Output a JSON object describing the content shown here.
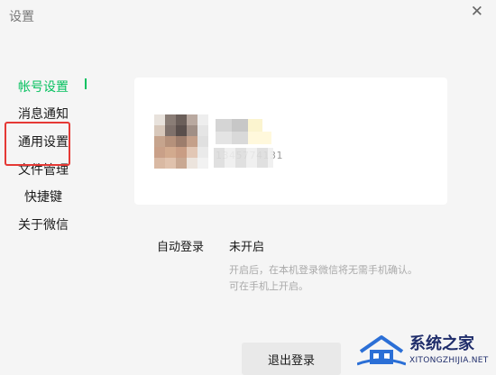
{
  "window": {
    "title": "设置"
  },
  "sidebar": {
    "items": [
      {
        "label": "帐号设置",
        "active": true
      },
      {
        "label": "消息通知"
      },
      {
        "label": "通用设置"
      },
      {
        "label": "文件管理"
      },
      {
        "label": "快捷键"
      },
      {
        "label": "关于微信"
      }
    ]
  },
  "account": {
    "wechat_id": "1345774131"
  },
  "auto_login": {
    "label": "自动登录",
    "value": "未开启",
    "desc_line1": "开启后，在本机登录微信将无需手机确认。",
    "desc_line2": "可在手机上开启。"
  },
  "logout_label": "退出登录",
  "watermark": {
    "text": "系统之家",
    "url": "XITONGZHIJIA.NET"
  },
  "colors": {
    "accent": "#07c160",
    "highlight": "#e53935"
  }
}
